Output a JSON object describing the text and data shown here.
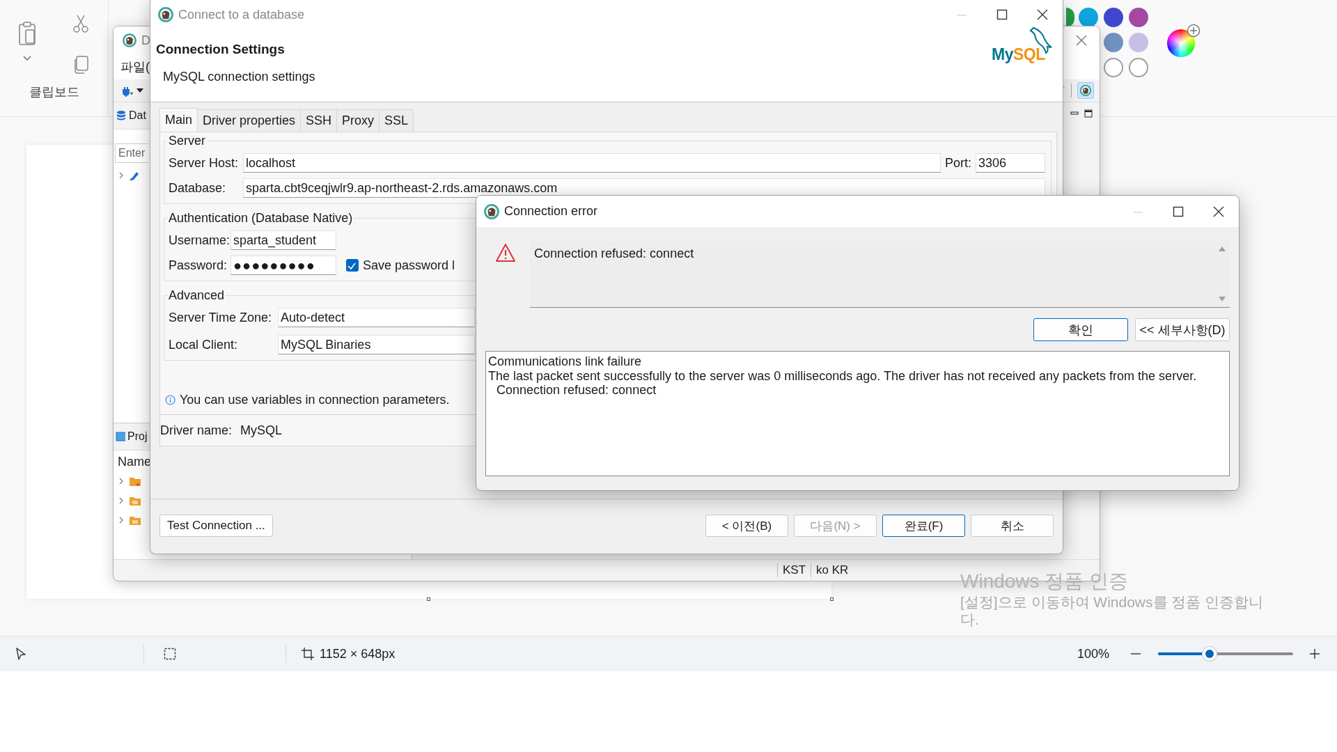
{
  "paint": {
    "ribbon": {
      "group_label": "클립보드"
    },
    "palette_rows": [
      [
        {
          "color": "#22a04b"
        },
        {
          "color": "#0ea5e0"
        },
        {
          "color": "#3f48cc"
        },
        {
          "color": "#a349a4"
        }
      ],
      [
        {
          "color": "#7092be"
        },
        {
          "color": "#c8bfe7"
        }
      ],
      [
        {
          "color": "#ffffff"
        },
        {
          "color": "#ffffff"
        }
      ]
    ],
    "status_bar": {
      "canvas_size": "1152 × 648px",
      "zoom": "100%",
      "zoom_slider": {
        "level": 0.38
      }
    }
  },
  "back_window": {
    "title": "D",
    "menu": "파일(",
    "explorer_tab": "Dat",
    "filter_placeholder": "Enter",
    "tree": [
      {
        "expanded": false
      }
    ],
    "projects_tab": "Proj",
    "projects_header": "Name",
    "projects": [
      {
        "expanded": false
      },
      {
        "expanded": false
      },
      {
        "expanded": false
      }
    ],
    "status_bar": [
      "KST",
      "ko KR"
    ]
  },
  "connect_dialog": {
    "title": "Connect to a database",
    "heading": "Connection Settings",
    "subheading": "MySQL connection settings",
    "logo": [
      "My",
      "SQL"
    ],
    "tabs": [
      {
        "label": "Main",
        "selected": true
      },
      {
        "label": "Driver properties",
        "selected": false
      },
      {
        "label": "SSH",
        "selected": false
      },
      {
        "label": "Proxy",
        "selected": false
      },
      {
        "label": "SSL",
        "selected": false
      }
    ],
    "server": {
      "title": "Server",
      "host_label": "Server Host:",
      "host": "localhost",
      "port_label": "Port:",
      "port": "3306",
      "database_label": "Database:",
      "database": "sparta.cbt9ceqjwlr9.ap-northeast-2.rds.amazonaws.com"
    },
    "auth": {
      "title": "Authentication (Database Native)",
      "username_label": "Username:",
      "username": "sparta_student",
      "password_label": "Password:",
      "password": "●●●●●●●●●",
      "save_password": {
        "label": "Save password l",
        "checked": true
      }
    },
    "advanced": {
      "title": "Advanced",
      "timezone_label": "Server Time Zone:",
      "timezone": "Auto-detect",
      "client_label": "Local Client:",
      "client": "MySQL Binaries"
    },
    "info": "You can use variables in connection parameters.",
    "driver": {
      "label": "Driver name:",
      "value": "MySQL"
    },
    "test_button": "Test Connection ...",
    "buttons": [
      {
        "label": "< 이전(B)",
        "disabled": false,
        "default": false
      },
      {
        "label": "다음(N) >",
        "disabled": true,
        "default": false
      },
      {
        "label": "완료(F)",
        "disabled": false,
        "default": true
      },
      {
        "label": "취소",
        "disabled": false,
        "default": false
      }
    ]
  },
  "error_dialog": {
    "title": "Connection error",
    "message": "Connection refused: connect",
    "buttons": [
      {
        "label": "확인",
        "default": true
      },
      {
        "label": "<< 세부사항(D)",
        "default": false
      }
    ],
    "details": [
      {
        "text": "Communications link failure",
        "indented": false
      },
      {
        "text": "The last packet sent successfully to the server was 0 milliseconds ago. The driver has not received any packets from the server.",
        "indented": false
      },
      {
        "text": "Connection refused: connect",
        "indented": true
      }
    ]
  },
  "activation_notice": {
    "title": "Windows 정품 인증",
    "text": "[설정]으로 이동하여 Windows를 정품 인증합니다."
  }
}
